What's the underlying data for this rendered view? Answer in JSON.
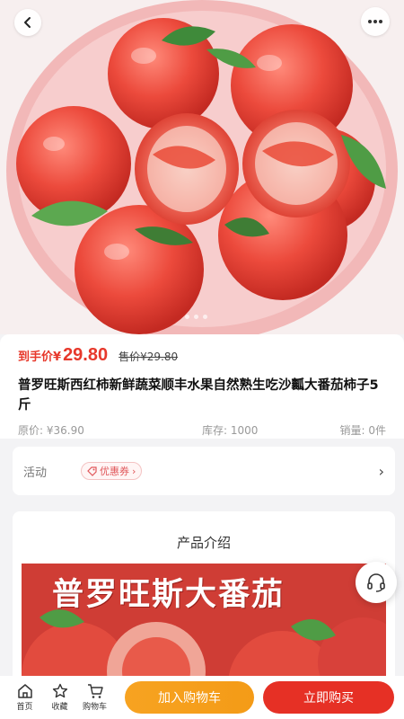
{
  "header": {
    "back_icon": "chevron-left-icon",
    "more_icon": "ellipsis-icon"
  },
  "hero": {
    "image_subject": "tomatoes-in-bowl",
    "slide_count": 3
  },
  "product": {
    "price_prefix": "到手价",
    "currency": "¥",
    "price": "29.80",
    "sale_price_strike": "售价¥29.80",
    "title": "普罗旺斯西红柿新鲜蔬菜顺丰水果自然熟生吃沙瓤大番茄柿子5斤",
    "original_price": "原价: ¥36.90",
    "stock": "库存: 1000",
    "sales": "销量: 0件"
  },
  "activity": {
    "label": "活动",
    "coupon": "优惠券",
    "coupon_arrow": "›",
    "chevron": "›"
  },
  "intro": {
    "title": "产品介绍",
    "banner_text": "普罗旺斯大番茄",
    "slide_count": 3
  },
  "service": {
    "icon": "headset-icon"
  },
  "bottom_nav": {
    "home": "首页",
    "favorite": "收藏",
    "cart": "购物车",
    "add_to_cart": "加入购物车",
    "buy_now": "立即购买"
  },
  "colors": {
    "price_red": "#e7382b",
    "cart_orange": "#f49b17",
    "buy_red": "#e63025"
  }
}
